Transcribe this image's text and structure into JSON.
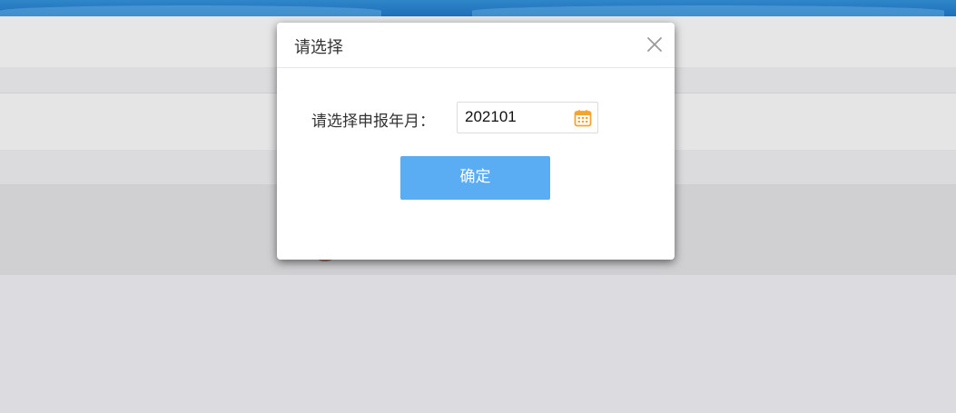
{
  "dialog": {
    "title": "请选择",
    "label": "请选择申报年月：",
    "value": "202101",
    "confirm_label": "确定",
    "icons": {
      "close": "close-icon",
      "calendar": "calendar-icon"
    }
  },
  "colors": {
    "accent": "#5aacf3",
    "calendar_icon": "#f3a52e",
    "banner": "#2f86c9",
    "overlay_bg": "#dcdde0"
  }
}
